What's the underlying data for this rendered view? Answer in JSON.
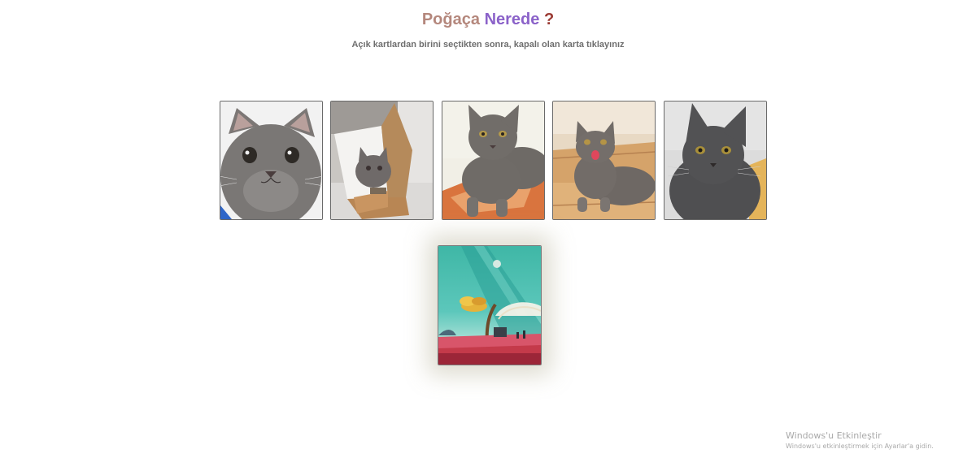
{
  "header": {
    "title_part1": "Poğaça",
    "title_part2": "Nerede",
    "title_part3": "?",
    "instruction": "Açık kartlardan birini seçtikten sonra, kapalı olan karta tıklayınız"
  },
  "open_cards": [
    {
      "name": "cat-photo-closeup"
    },
    {
      "name": "cat-photo-in-box"
    },
    {
      "name": "cat-photo-on-rug"
    },
    {
      "name": "cat-photo-tongue-out"
    },
    {
      "name": "cat-photo-grey"
    }
  ],
  "closed_card": {
    "name": "card-back-landscape"
  },
  "watermark": {
    "line1": "Windows'u Etkinleştir",
    "line2": "Windows'u etkinleştirmek için Ayarlar'a gidin."
  },
  "colors": {
    "title_part1": "#b4877c",
    "title_part2": "#8b62c9",
    "title_part3": "#9b3b34",
    "instruction": "#6f6f6f"
  }
}
